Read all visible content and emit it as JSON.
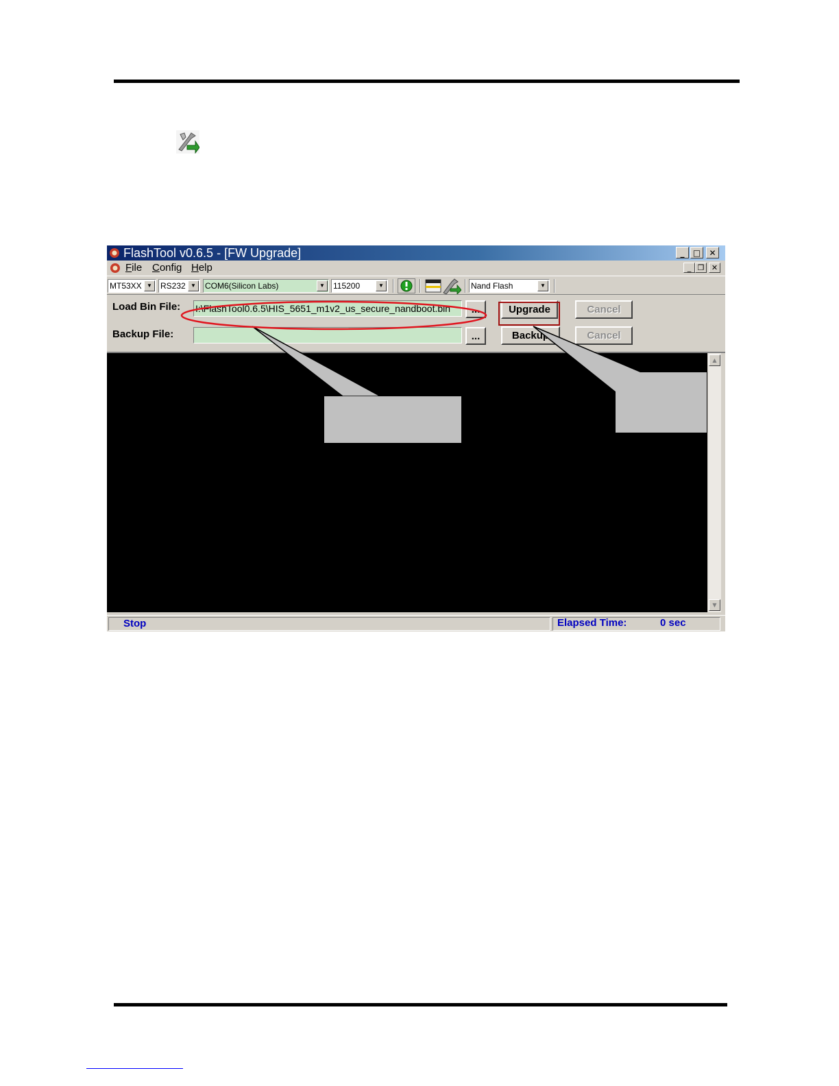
{
  "window": {
    "title": "FlashTool v0.6.5 - [FW Upgrade]",
    "caption_buttons": {
      "minimize": "_",
      "maximize": "□",
      "close": "✕"
    },
    "mdi_buttons": {
      "minimize": "_",
      "restore": "❐",
      "close": "✕"
    }
  },
  "menu": {
    "items": [
      "File",
      "Config",
      "Help"
    ]
  },
  "toolbar": {
    "chip": "MT53XX",
    "port_type": "RS232",
    "com_port": "COM6(Silicon Labs)",
    "baud_rate": "115200",
    "flash_type": "Nand Flash"
  },
  "load": {
    "label": "Load Bin File:",
    "value": "I:\\FlashTool0.6.5\\HIS_5651_m1v2_us_secure_nandboot.bin",
    "browse": "...",
    "action": "Upgrade",
    "cancel": "Cancel"
  },
  "backup": {
    "label": "Backup File:",
    "value": "",
    "browse": "...",
    "action": "Backup",
    "cancel": "Cancel"
  },
  "status": {
    "state": "Stop",
    "elapsed_label": "Elapsed Time:",
    "elapsed_value": "0 sec"
  },
  "colors": {
    "field_green": "#c8e6c8",
    "status_blue": "#0000c0",
    "annotation_red": "#e0141e"
  },
  "icons": [
    "flashtool-app-icon",
    "connect-icon",
    "tools-icon"
  ]
}
